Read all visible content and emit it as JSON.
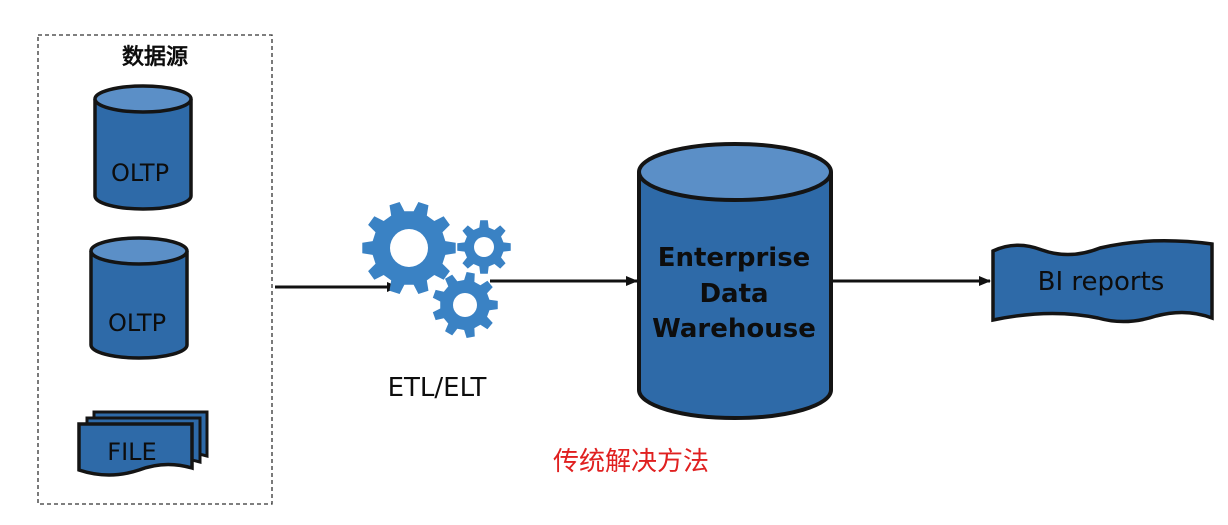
{
  "diagram": {
    "source_group": {
      "title": "数据源",
      "databases": [
        {
          "label": "OLTP"
        },
        {
          "label": "OLTP"
        }
      ],
      "file": {
        "label": "FILE"
      }
    },
    "etl": {
      "label": "ETL/ELT",
      "icon": "gears-icon"
    },
    "warehouse": {
      "line1": "Enterprise",
      "line2": "Data",
      "line3": "Warehouse"
    },
    "reports": {
      "label": "BI reports"
    },
    "caption": "传统解决方法",
    "colors": {
      "shape_fill": "#2e6aa8",
      "shape_fill_light": "#5b8fc7",
      "shape_stroke": "#141414",
      "gear_fill": "#3a82c4",
      "caption": "#e02020",
      "arrow": "#111111"
    }
  }
}
